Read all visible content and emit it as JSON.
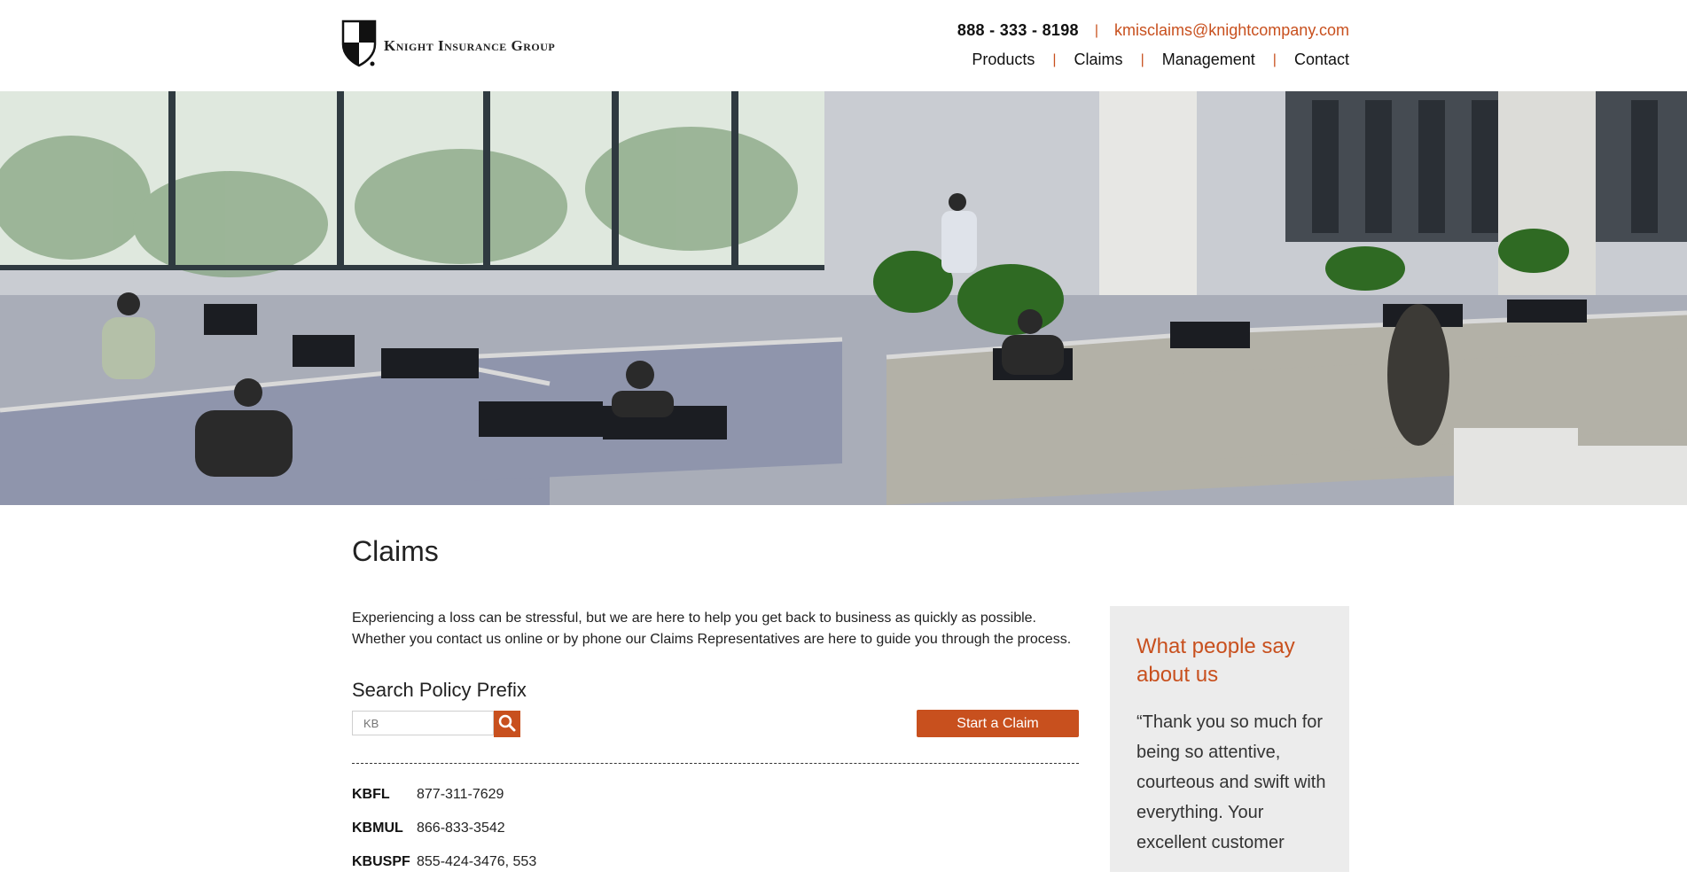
{
  "header": {
    "logo_text": "Knight Insurance Group",
    "phone": "888 - 333 - 8198",
    "email": "kmisclaims@knightcompany.com",
    "nav": [
      "Products",
      "Claims",
      "Management",
      "Contact"
    ]
  },
  "colors": {
    "accent": "#c8501e",
    "panel": "#ececec"
  },
  "main": {
    "title": "Claims",
    "intro_line1": "Experiencing a loss can be stressful, but we are here to help you get back to business as quickly as possible.",
    "intro_line2": "Whether you contact us online or by phone our Claims Representatives are here to guide you through the process.",
    "search_title": "Search Policy Prefix",
    "search_placeholder": "KB",
    "start_claim_label": "Start a Claim",
    "prefixes": [
      {
        "code": "KBFL",
        "phone": "877-311-7629"
      },
      {
        "code": "KBMUL",
        "phone": "866-833-3542"
      },
      {
        "code": "KBUSPF",
        "phone": "855-424-3476, 553"
      }
    ]
  },
  "testimonial": {
    "heading": "What people say about us",
    "quote": "“Thank you so much for being so attentive, courteous and swift with everything. Your excellent customer"
  }
}
